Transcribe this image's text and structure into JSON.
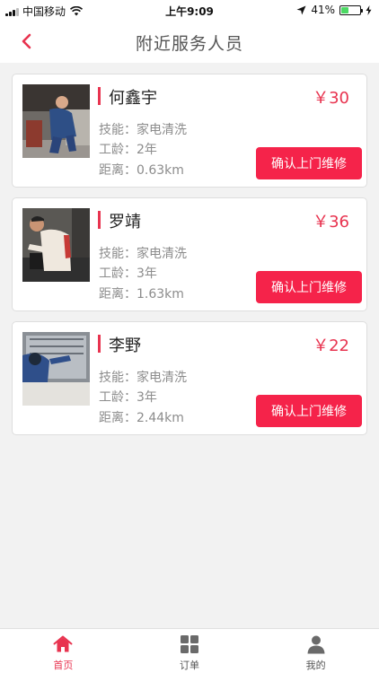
{
  "status_bar": {
    "carrier": "中国移动",
    "time": "上午9:09",
    "battery": "41%",
    "battery_level": 0.41
  },
  "nav": {
    "title": "附近服务人员"
  },
  "workers": [
    {
      "name": "何鑫宇",
      "price": "￥30",
      "skill": "技能：家电清洗",
      "years": "工龄：2年",
      "distance": "距离：0.63km",
      "button": "确认上门维修"
    },
    {
      "name": "罗靖",
      "price": "￥36",
      "skill": "技能：家电清洗",
      "years": "工龄：3年",
      "distance": "距离：1.63km",
      "button": "确认上门维修"
    },
    {
      "name": "李野",
      "price": "￥22",
      "skill": "技能：家电清洗",
      "years": "工龄：3年",
      "distance": "距离：2.44km",
      "button": "确认上门维修"
    }
  ],
  "tabs": [
    {
      "label": "首页",
      "icon": "home-icon",
      "active": true
    },
    {
      "label": "订单",
      "icon": "grid-icon",
      "active": false
    },
    {
      "label": "我的",
      "icon": "user-icon",
      "active": false
    }
  ],
  "colors": {
    "accent": "#e8334f",
    "button": "#f5234a"
  }
}
